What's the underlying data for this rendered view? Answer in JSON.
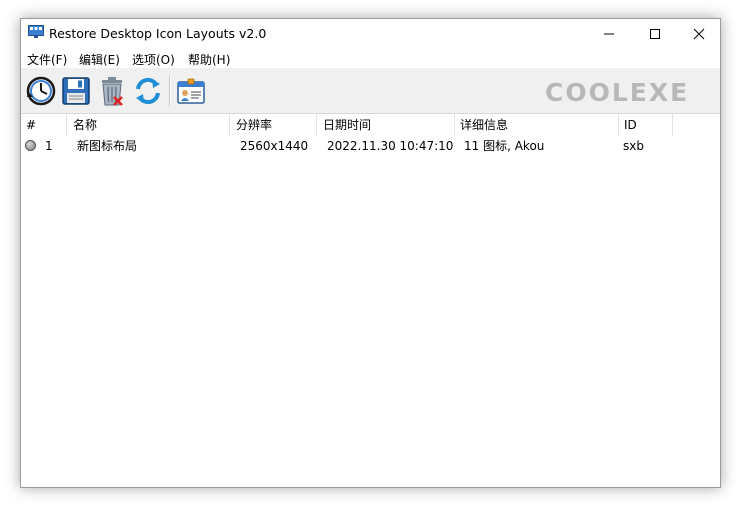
{
  "window": {
    "title": "Restore Desktop Icon Layouts v2.0"
  },
  "menu": {
    "items": [
      "文件(F)",
      "编辑(E)",
      "选项(O)",
      "帮助(H)"
    ]
  },
  "toolbar": {
    "brand": "COOLEXE",
    "buttons": [
      "restore-icon",
      "save-icon",
      "delete-icon",
      "refresh-icon",
      "properties-icon"
    ]
  },
  "table": {
    "columns": [
      "#",
      "名称",
      "分辨率",
      "日期时间",
      "详细信息",
      "ID"
    ],
    "rows": [
      {
        "num": "1",
        "name": "新图标布局",
        "resolution": "2560x1440",
        "datetime": "2022.11.30 10:47:10",
        "details": "11 图标, Akou",
        "id": "sxb"
      }
    ]
  }
}
